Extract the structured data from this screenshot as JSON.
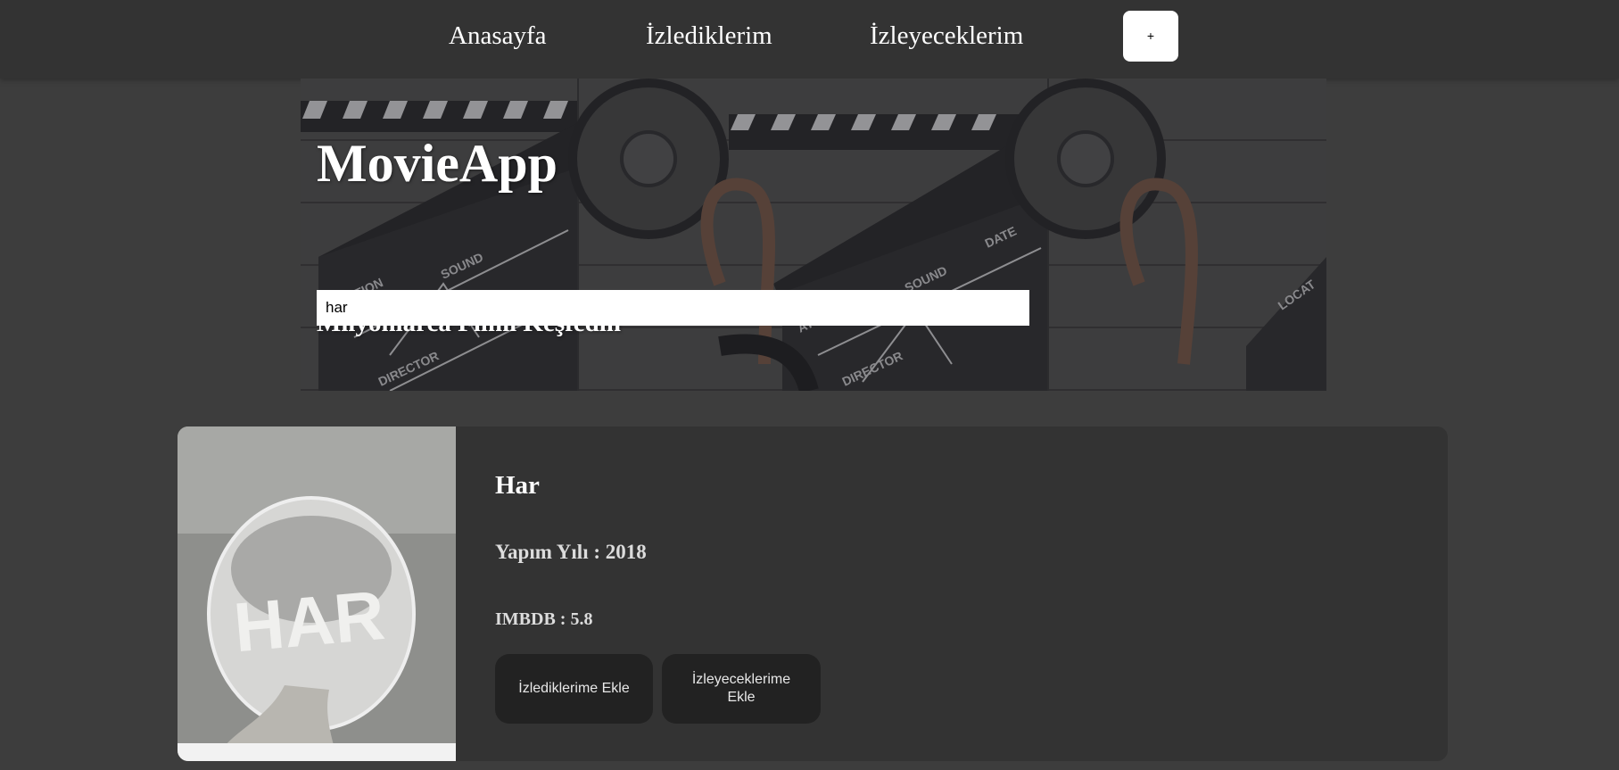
{
  "nav": {
    "items": [
      {
        "label": "Anasayfa"
      },
      {
        "label": "İzlediklerim"
      },
      {
        "label": "İzleyeceklerim"
      }
    ],
    "add_button_label": "+"
  },
  "hero": {
    "title": "MovieApp",
    "subtitle": "Milyonlarca Filmi Keşfedin"
  },
  "search": {
    "value": "har"
  },
  "movie": {
    "title": "Har",
    "year_text": "Yapım Yılı : 2018",
    "rating_text": "IMBDB : 5.8",
    "poster_text": "HAR",
    "add_watched_label": "İzlediklerime Ekle",
    "add_watchlist_label": "İzleyeceklerime Ekle"
  },
  "colors": {
    "page_background": "#3d3d3d",
    "navbar_background": "#333333",
    "card_background": "#333333",
    "button_background": "#222222",
    "text": "#ffffff"
  },
  "icons": {
    "hero_image": "film-clapperboard-and-reel",
    "poster_image": "light-bulb-poster"
  }
}
